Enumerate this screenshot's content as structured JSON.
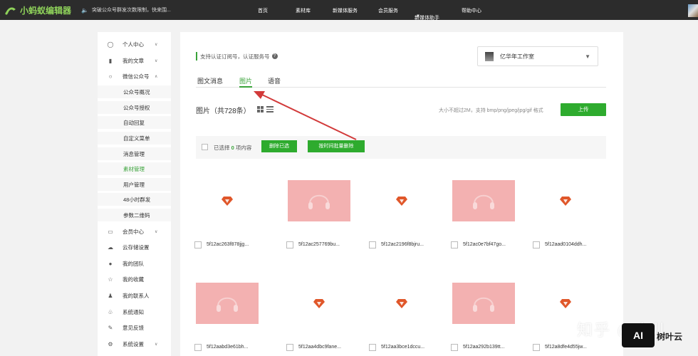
{
  "topbar": {
    "logo_text": "小蚂蚁编辑器",
    "notice": "突破公众号群发次数限制，快来围...",
    "nav": [
      "首页",
      "素材库",
      "新媒体服务",
      "会员服务",
      "新媒体助手",
      "帮助中心"
    ]
  },
  "sidebar": {
    "items": [
      {
        "label": "个人中心",
        "icon": "user-icon",
        "arrow": "down"
      },
      {
        "label": "我的文章",
        "icon": "document-icon",
        "arrow": "down"
      },
      {
        "label": "微信公众号",
        "icon": "wechat-icon",
        "arrow": "up"
      }
    ],
    "sub_items": [
      {
        "label": "公众号概况"
      },
      {
        "label": "公众号授权"
      },
      {
        "label": "自动回复"
      },
      {
        "label": "自定义菜单"
      },
      {
        "label": "消息管理"
      },
      {
        "label": "素材管理",
        "active": true
      },
      {
        "label": "用户管理"
      },
      {
        "label": "48小时群发"
      },
      {
        "label": "参数二维码"
      }
    ],
    "bottom_items": [
      {
        "label": "会员中心",
        "icon": "card-icon",
        "arrow": "down"
      },
      {
        "label": "云存储设置",
        "icon": "cloud-icon"
      },
      {
        "label": "我的团队",
        "icon": "team-icon"
      },
      {
        "label": "我的收藏",
        "icon": "star-icon"
      },
      {
        "label": "我的联系人",
        "icon": "contact-add-icon"
      },
      {
        "label": "系统通知",
        "icon": "bell-icon"
      },
      {
        "label": "意见反馈",
        "icon": "edit-icon"
      },
      {
        "label": "系统设置",
        "icon": "gear-icon",
        "arrow": "down"
      }
    ]
  },
  "main": {
    "support_note": "支持认证订阅号，认证服务号",
    "account_name": "亿华年工作室",
    "tabs": [
      "图文消息",
      "图片",
      "语音"
    ],
    "active_tab": "图片",
    "images_title": "图片（共728条）",
    "upload_hint": "大小不超过2M，支持 bmp/png/jpeg/jpg/gif 格式",
    "upload_label": "上传",
    "selection": {
      "prefix": "已选择",
      "count": "0",
      "suffix": "项内容"
    },
    "delete_selected_label": "删除已选",
    "delete_by_time_label": "按时间批量删除",
    "cards": [
      {
        "name": "5f12ac263f878jjg...",
        "thumb": "gem"
      },
      {
        "name": "5f12ac257769bu...",
        "thumb": "pink"
      },
      {
        "name": "5f12ac2196f8bjru...",
        "thumb": "gem"
      },
      {
        "name": "5f12ac0e7bf47go...",
        "thumb": "pink"
      },
      {
        "name": "5f12aad0104ddh...",
        "thumb": "gem"
      },
      {
        "name": "5f12aabd3e61bh...",
        "thumb": "pink"
      },
      {
        "name": "5f12aa4dbc9fane...",
        "thumb": "gem"
      },
      {
        "name": "5f12aa3bce1dccu...",
        "thumb": "gem"
      },
      {
        "name": "5f12aa292b139tt...",
        "thumb": "pink"
      },
      {
        "name": "5f12a8dfe4d55jw...",
        "thumb": "gem"
      }
    ]
  },
  "watermark": {
    "platform": "知乎 @介儿",
    "badge": "AI",
    "brand": "树叶云"
  },
  "colors": {
    "accent": "#2eab2e",
    "topbar": "#2c2c2c",
    "annotation_arrow": "#d23a3a",
    "thumb_pink": "#f3b1b1",
    "gem": "#e0572a"
  }
}
